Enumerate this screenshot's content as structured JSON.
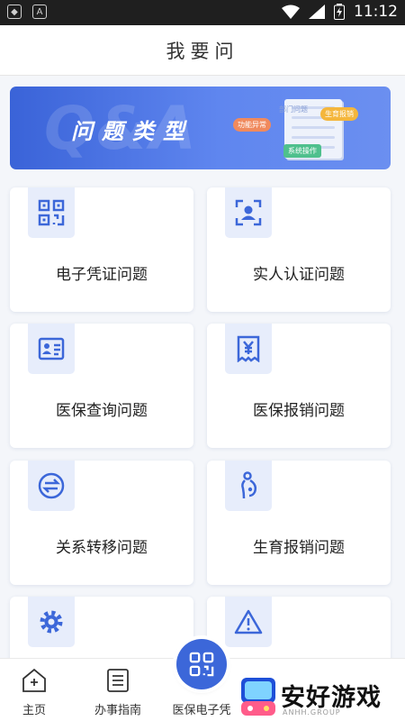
{
  "status_bar": {
    "time": "11:12"
  },
  "header": {
    "title": "我要问"
  },
  "banner": {
    "title": "问题类型",
    "bg_text": "Q&A",
    "tags": {
      "dept": "部门问题",
      "func": "功能异常",
      "birth": "生育报销",
      "sys": "系统操作"
    }
  },
  "cards": [
    {
      "label": "电子凭证问题",
      "icon": "qr-code-icon"
    },
    {
      "label": "实人认证问题",
      "icon": "face-scan-icon"
    },
    {
      "label": "医保查询问题",
      "icon": "id-card-icon"
    },
    {
      "label": "医保报销问题",
      "icon": "receipt-yen-icon"
    },
    {
      "label": "关系转移问题",
      "icon": "transfer-icon"
    },
    {
      "label": "生育报销问题",
      "icon": "pregnant-icon"
    },
    {
      "label": "",
      "icon": "gear-icon"
    },
    {
      "label": "",
      "icon": "warning-icon"
    }
  ],
  "tabbar": {
    "home": "主页",
    "guide": "办事指南",
    "voucher": "医保电子凭"
  },
  "watermark": {
    "text": "安好游戏",
    "sub": "ANHH.GROUP"
  },
  "colors": {
    "accent": "#3c67d9",
    "icon_bg": "#e7edfb"
  }
}
